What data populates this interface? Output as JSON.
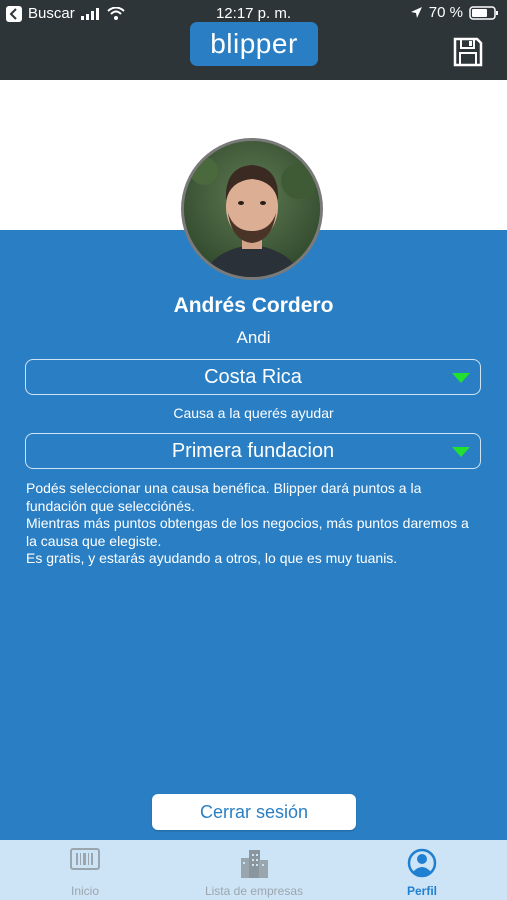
{
  "status_bar": {
    "carrier": "Buscar",
    "time": "12:17 p. m.",
    "battery": "70 %"
  },
  "header": {
    "logo": "blipper",
    "save_icon": "save-icon"
  },
  "profile": {
    "name": "Andrés Cordero",
    "nickname": "Andi"
  },
  "country_select": {
    "value": "Costa Rica"
  },
  "cause": {
    "label": "Causa a la querés ayudar",
    "value": "Primera fundacion"
  },
  "info": {
    "line1": "Podés seleccionar una causa benéfica. Blipper dará puntos a la fundación que selecciónés.",
    "line2": "Mientras más puntos obtengas de los negocios, más puntos daremos a la causa que elegiste.",
    "line3": "Es gratis, y estarás ayudando a otros, lo que es muy tuanis."
  },
  "logout_label": "Cerrar sesión",
  "tabs": [
    {
      "label": "Inicio",
      "icon": "barcode-icon"
    },
    {
      "label": "Lista de empresas",
      "icon": "buildings-icon"
    },
    {
      "label": "Perfil",
      "icon": "user-icon"
    }
  ],
  "colors": {
    "primary": "#2a7fc4",
    "dark_bar": "#2e3538",
    "tab_active": "#1f7fd1",
    "arrow": "#22e030"
  }
}
